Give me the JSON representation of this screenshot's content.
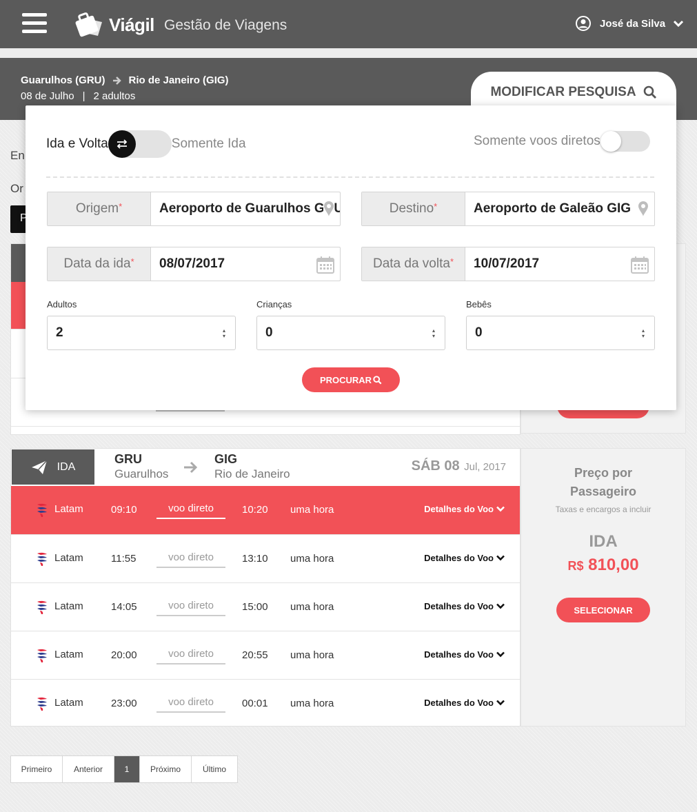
{
  "header": {
    "brand": "Viágil",
    "app_title": "Gestão de Viagens",
    "user_name": "José da Silva"
  },
  "summary": {
    "origin": "Guarulhos (GRU)",
    "destination": "Rio de Janeiro (GIG)",
    "date": "08 de Julho",
    "separator": "|",
    "passengers": "2 adultos",
    "modify_label": "MODIFICAR PESQUISA"
  },
  "background": {
    "partial_text_1": "En",
    "partial_text_2": "Or",
    "partial_text_3": "P"
  },
  "search": {
    "trip_round": "Ida e Volta",
    "trip_oneway": "Somente Ida",
    "direct_only": "Somente voos diretos",
    "origin_label": "Origem",
    "origin_value": "Aeroporto de Guarulhos GRU",
    "dest_label": "Destino",
    "dest_value": "Aeroporto de Galeão GIG",
    "depart_label": "Data da ida",
    "depart_value": "08/07/2017",
    "return_label": "Data da volta",
    "return_value": "10/07/2017",
    "required_mark": "*",
    "adults_label": "Adultos",
    "adults_value": "2",
    "children_label": "Crianças",
    "children_value": "0",
    "infants_label": "Bebês",
    "infants_value": "0",
    "search_button": "PROCURAR"
  },
  "results": {
    "direction": "IDA",
    "origin_code": "GRU",
    "origin_city": "Guarulhos",
    "dest_code": "GIG",
    "dest_city": "Rio de Janeiro",
    "date_day": "SÁB 08",
    "date_rest": "Jul, 2017",
    "flights": [
      {
        "airline": "Latam",
        "depart": "09:10",
        "stop": "voo direto",
        "arrive": "10:20",
        "duration": "uma hora",
        "details": "Detalhes do Voo"
      },
      {
        "airline": "Latam",
        "depart": "11:55",
        "stop": "voo direto",
        "arrive": "13:10",
        "duration": "uma hora",
        "details": "Detalhes do Voo"
      },
      {
        "airline": "Latam",
        "depart": "14:05",
        "stop": "voo direto",
        "arrive": "15:00",
        "duration": "uma hora",
        "details": "Detalhes do Voo"
      },
      {
        "airline": "Latam",
        "depart": "20:00",
        "stop": "voo direto",
        "arrive": "20:55",
        "duration": "uma hora",
        "details": "Detalhes do Voo"
      },
      {
        "airline": "Latam",
        "depart": "23:00",
        "stop": "voo direto",
        "arrive": "00:01",
        "duration": "uma hora",
        "details": "Detalhes do Voo"
      }
    ]
  },
  "price": {
    "title_line1": "Preço por",
    "title_line2": "Passageiro",
    "note": "Taxas e encargos a incluir",
    "direction": "IDA",
    "currency": "R$",
    "amount": "810,00",
    "select_button": "SELECIONAR"
  },
  "pagination": {
    "first": "Primeiro",
    "prev": "Anterior",
    "current": "1",
    "next": "Próximo",
    "last": "Último"
  },
  "colors": {
    "accent": "#f25157",
    "header": "#5a5a5a"
  }
}
